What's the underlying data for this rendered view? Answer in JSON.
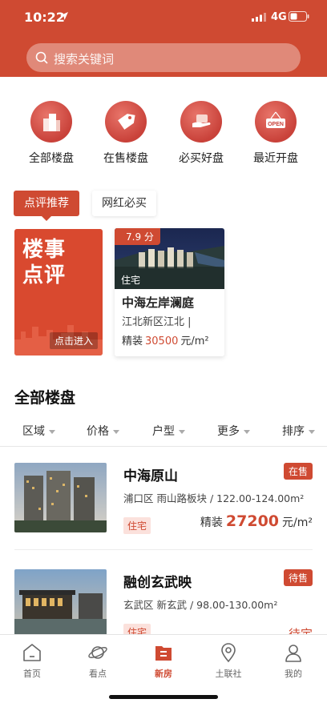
{
  "status_bar": {
    "time": "10:22",
    "network": "4G"
  },
  "search": {
    "placeholder": "搜索关键词"
  },
  "categories": [
    {
      "label": "全部楼盘",
      "icon": "buildings-icon"
    },
    {
      "label": "在售楼盘",
      "icon": "price-tag-icon"
    },
    {
      "label": "必买好盘",
      "icon": "hand-offer-icon"
    },
    {
      "label": "最近开盘",
      "icon": "open-sign-icon",
      "sign_text": "OPEN"
    }
  ],
  "tabs": {
    "active": "点评推荐",
    "inactive": "网红必买"
  },
  "review_card": {
    "title_line1": "楼事",
    "title_line2": "点评",
    "cta": "点击进入"
  },
  "featured": {
    "score": "7.9 分",
    "type": "住宅",
    "name": "中海左岸澜庭",
    "location": "江北新区江北 |",
    "price_prefix": "精装",
    "price": "30500",
    "price_unit": "元/m²"
  },
  "list": {
    "title": "全部楼盘",
    "filters": [
      "区域",
      "价格",
      "户型",
      "更多",
      "排序"
    ],
    "items": [
      {
        "name": "中海原山",
        "status": "在售",
        "meta": "浦口区 雨山路板块 / 122.00-124.00m²",
        "kind": "住宅",
        "price_prefix": "精装",
        "price": "27200",
        "price_unit": "元/m²"
      },
      {
        "name": "融创玄武映",
        "status": "待售",
        "meta": "玄武区 新玄武 / 98.00-130.00m²",
        "kind": "住宅",
        "price_text": "待定"
      }
    ]
  },
  "tabbar": [
    {
      "label": "首页",
      "icon": "home-icon"
    },
    {
      "label": "看点",
      "icon": "planet-icon"
    },
    {
      "label": "新房",
      "icon": "new-house-icon",
      "active": true
    },
    {
      "label": "土联社",
      "icon": "map-pin-icon"
    },
    {
      "label": "我的",
      "icon": "profile-icon"
    }
  ],
  "colors": {
    "brand": "#cf4a32",
    "tag_bg": "#fbe1dc"
  }
}
